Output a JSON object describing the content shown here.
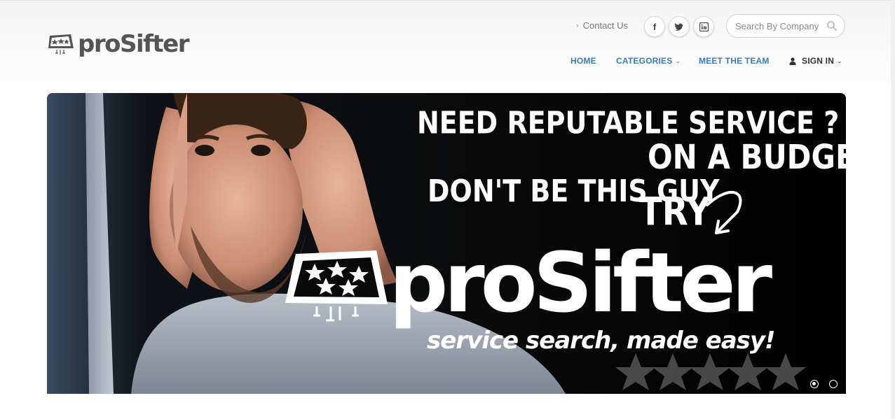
{
  "brand": {
    "name": "proSifter"
  },
  "header": {
    "contact_label": "Contact Us",
    "social": [
      {
        "name": "facebook",
        "glyph": "f"
      },
      {
        "name": "twitter",
        "glyph": "t"
      },
      {
        "name": "linkedin",
        "glyph": "in"
      }
    ],
    "search": {
      "placeholder": "Search By Company"
    }
  },
  "nav": {
    "items": [
      {
        "label": "HOME"
      },
      {
        "label": "CATEGORIES"
      },
      {
        "label": "MEET THE TEAM"
      },
      {
        "label": "SIGN IN"
      }
    ]
  },
  "hero": {
    "line1": "NEED REPUTABLE SERVICE ?",
    "line2": "ON A BUDGET ?",
    "line3": "DON'T BE THIS GUY",
    "line4": "TRY",
    "brand": "proSifter",
    "tagline": "service search, made easy!",
    "slides": 2,
    "active_slide": 1
  },
  "section": {
    "heading": ""
  },
  "colors": {
    "nav_link": "#3b7bb4",
    "nav_dark": "#333333",
    "logo": "#555555"
  }
}
